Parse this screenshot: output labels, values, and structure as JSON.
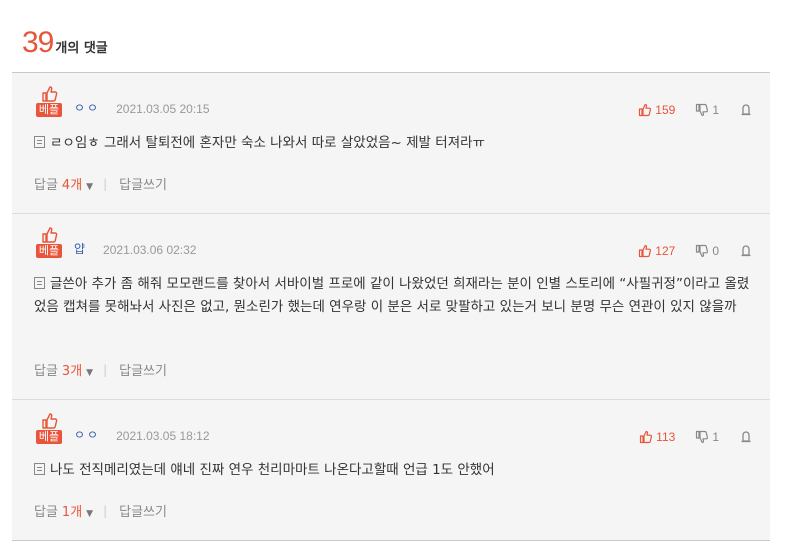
{
  "header": {
    "count": "39",
    "label": "개의 댓글"
  },
  "best_label": "베플",
  "comments": [
    {
      "nickname": "ㅇㅇ",
      "date": "2021.03.05 20:15",
      "likes": "159",
      "dislikes": "1",
      "text": "ㄹㅇ임ㅎ 그래서 탈퇴전에 혼자만 숙소 나와서 따로 살았었음~ 제발 터져라ㅠ",
      "reply_label": "답글",
      "reply_count": "4개",
      "write_label": "답글쓰기"
    },
    {
      "nickname": "얍",
      "date": "2021.03.06 02:32",
      "likes": "127",
      "dislikes": "0",
      "text": "글쓴아 추가 좀 해줘 모모랜드를 찾아서 서바이벌 프로에 같이 나왔었던 희재라는 분이 인별 스토리에 “사필귀정”이라고 올렸었음 캡쳐를 못해놔서 사진은 없고, 뭔소린가 했는데 연우랑 이 분은 서로 맞팔하고 있는거 보니 분명 무슨 연관이 있지 않을까",
      "reply_label": "답글",
      "reply_count": "3개",
      "write_label": "답글쓰기"
    },
    {
      "nickname": "ㅇㅇ",
      "date": "2021.03.05 18:12",
      "likes": "113",
      "dislikes": "1",
      "text": "나도 전직메리였는데 얘네 진짜 연우 천리마마트 나온다고할때 언급 1도 안했어",
      "reply_label": "답글",
      "reply_count": "1개",
      "write_label": "답글쓰기"
    }
  ],
  "icons": {
    "best": "thumbs-up-icon",
    "like": "thumbs-up-outline-icon",
    "dislike": "thumbs-down-outline-icon",
    "report": "report-icon",
    "content": "document-icon",
    "caret": "caret-down-icon"
  },
  "colors": {
    "accent": "#e8553a",
    "nickname": "#3a5fb0",
    "background": "#f5f5f5"
  }
}
